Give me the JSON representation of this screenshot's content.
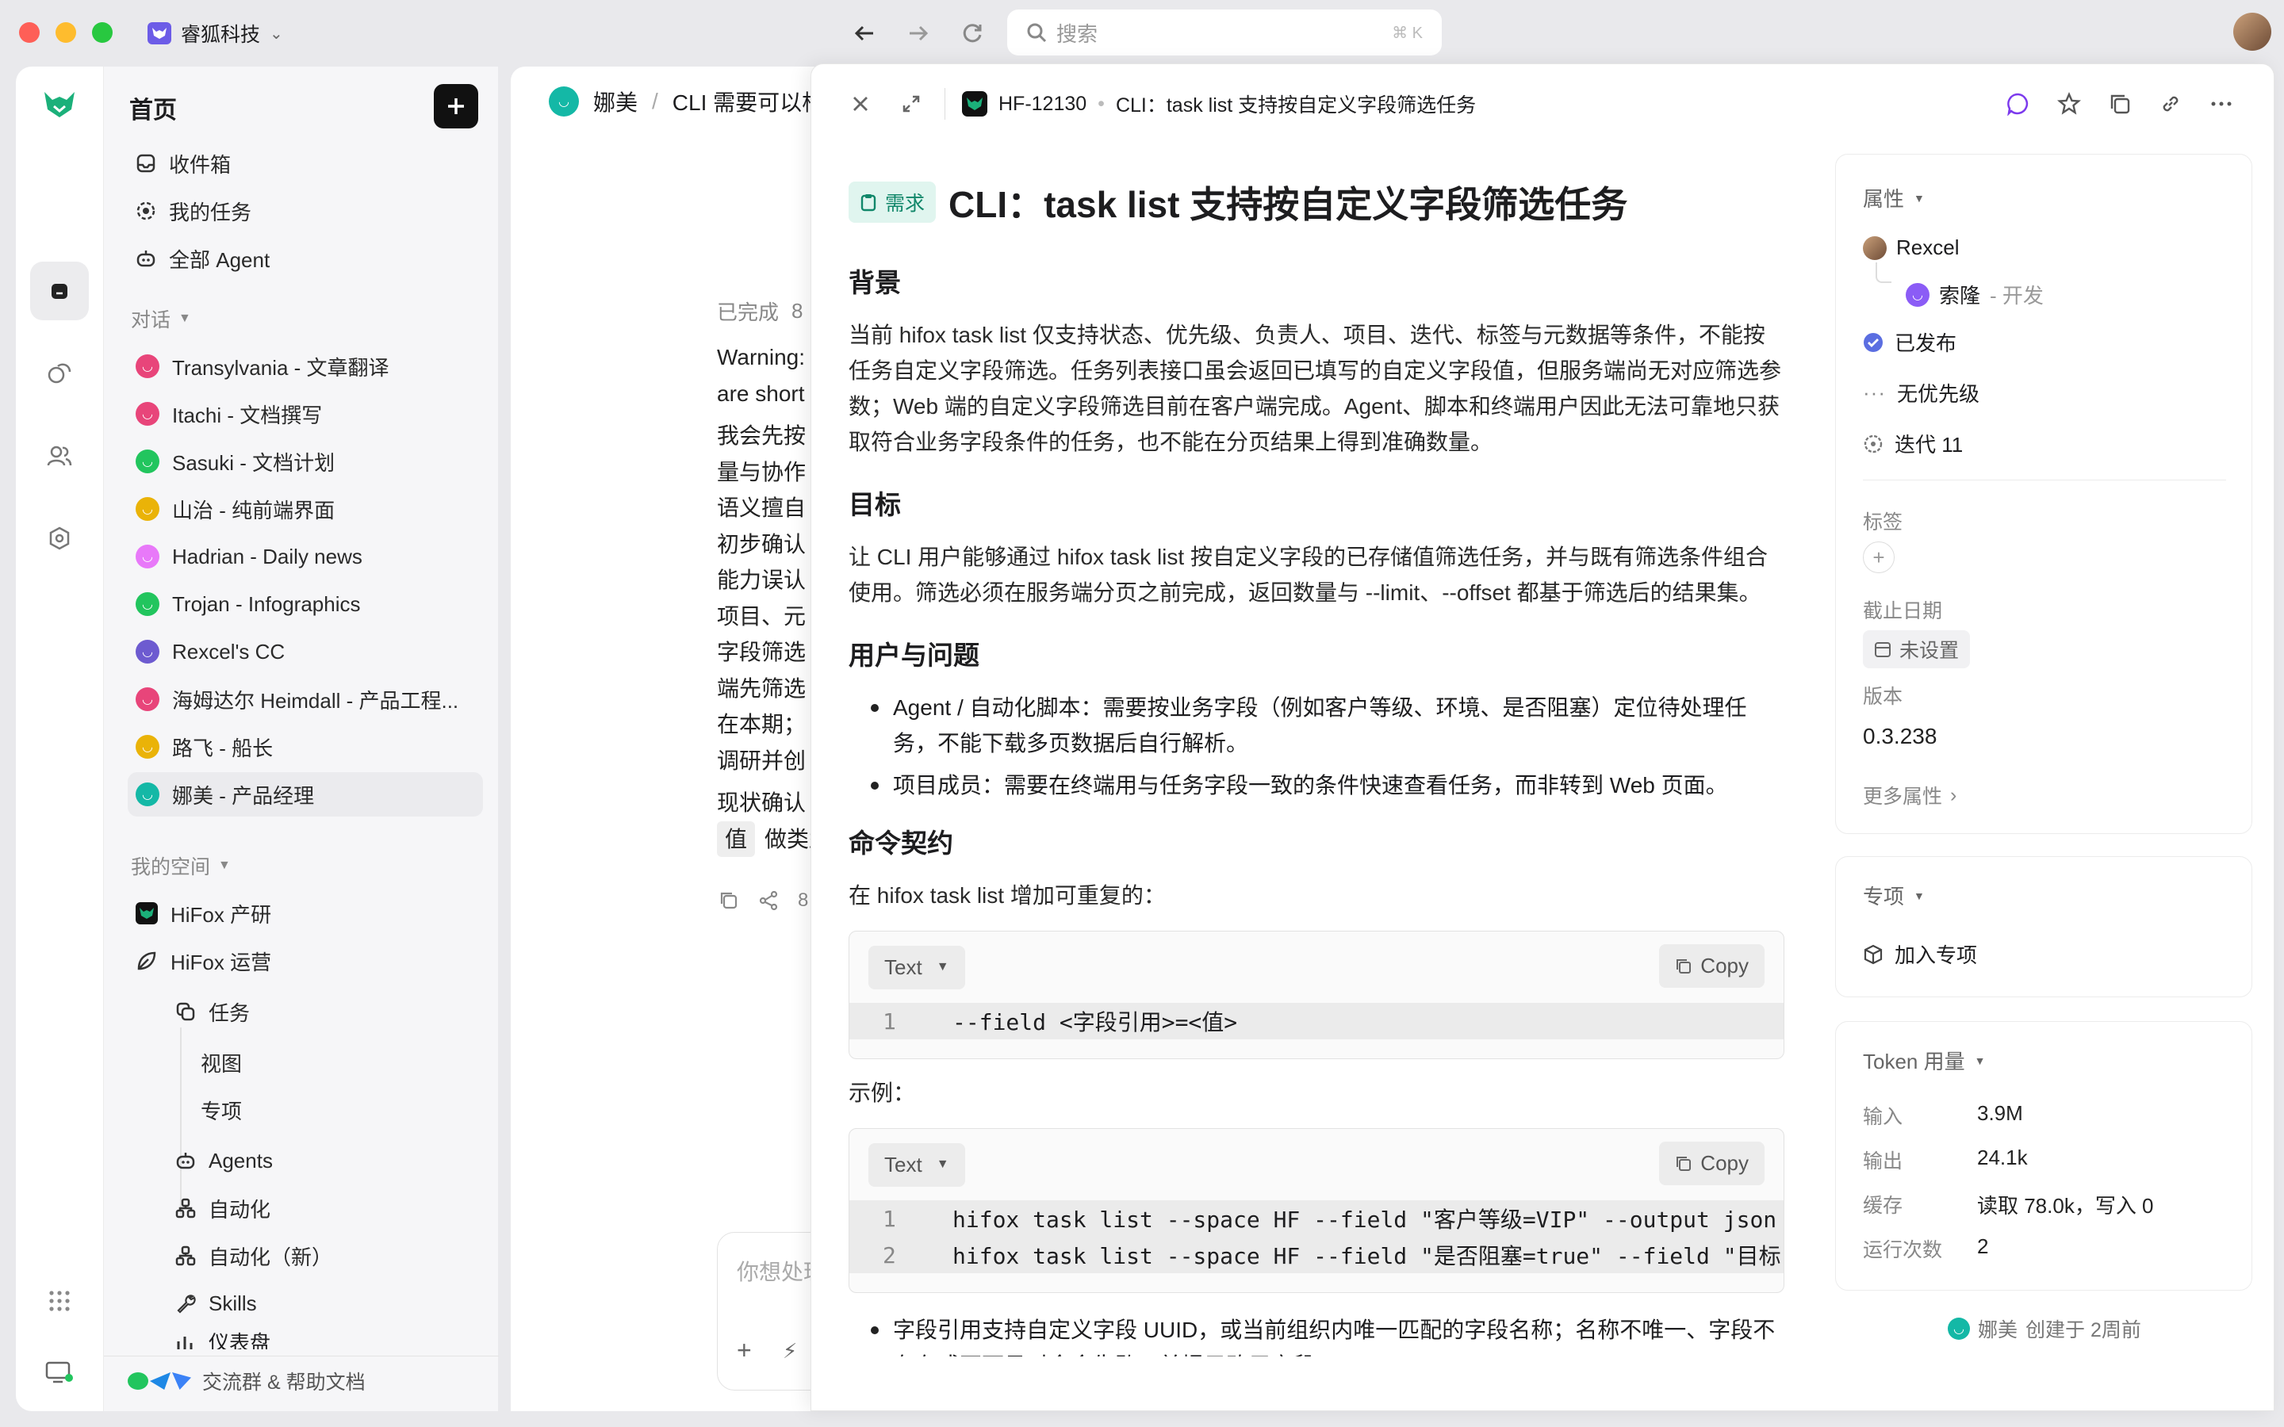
{
  "titlebar": {
    "workspace": "睿狐科技",
    "search_placeholder": "搜索",
    "search_shortcut": "⌘ K"
  },
  "sidebar": {
    "home": "首页",
    "top_items": [
      "收件箱",
      "我的任务",
      "全部 Agent"
    ],
    "chat_section": "对话",
    "chats": [
      {
        "label": "Transylvania - 文章翻译",
        "color": "#e8457a"
      },
      {
        "label": "Itachi - 文档撰写",
        "color": "#e8457a"
      },
      {
        "label": "Sasuki - 文档计划",
        "color": "#22c55e"
      },
      {
        "label": "山治 - 纯前端界面",
        "color": "#eab308"
      },
      {
        "label": "Hadrian - Daily news",
        "color": "#e879f9"
      },
      {
        "label": "Trojan - Infographics",
        "color": "#22c55e"
      },
      {
        "label": "Rexcel's CC",
        "color": "#6d5bd0"
      },
      {
        "label": "海姆达尔 Heimdall - 产品工程...",
        "color": "#e8457a"
      },
      {
        "label": "路飞 - 船长",
        "color": "#eab308"
      },
      {
        "label": "娜美 - 产品经理",
        "color": "#14b8a6"
      }
    ],
    "space_section": "我的空间",
    "spaces": [
      "HiFox 产研",
      "HiFox 运营"
    ],
    "ops_children": [
      "任务",
      "视图",
      "专项",
      "Agents",
      "自动化",
      "自动化（新）",
      "Skills",
      "仪表盘"
    ],
    "footer": "交流群 & 帮助文档"
  },
  "chat": {
    "agent": "娜美",
    "title": "CLI 需要可以根",
    "done_label": "已完成",
    "done_count": "8",
    "lines": [
      "Warning:",
      "are short",
      "我会先按",
      "量与协作",
      "语义擅自",
      "初步确认",
      "能力误认",
      "项目、元",
      "字段筛选",
      "端先筛选",
      "在本期；",
      "调研并创",
      "现状确认",
      "值",
      "做类型"
    ],
    "action_count": "8",
    "input_placeholder": "你想处理"
  },
  "issue": {
    "key": "HF-12130",
    "breadcrumb_title": "CLI：task list 支持按自定义字段筛选任务",
    "badge": "需求",
    "title": "CLI：task list 支持按自定义字段筛选任务",
    "bg_h": "背景",
    "bg_p": "当前 hifox task list 仅支持状态、优先级、负责人、项目、迭代、标签与元数据等条件，不能按任务自定义字段筛选。任务列表接口虽会返回已填写的自定义字段值，但服务端尚无对应筛选参数；Web 端的自定义字段筛选目前在客户端完成。Agent、脚本和终端用户因此无法可靠地只获取符合业务字段条件的任务，也不能在分页结果上得到准确数量。",
    "goal_h": "目标",
    "goal_p": "让 CLI 用户能够通过 hifox task list 按自定义字段的已存储值筛选任务，并与既有筛选条件组合使用。筛选必须在服务端分页之前完成，返回数量与 --limit、--offset 都基于筛选后的结果集。",
    "users_h": "用户与问题",
    "users": [
      "Agent / 自动化脚本：需要按业务字段（例如客户等级、环境、是否阻塞）定位待处理任务，不能下载多页数据后自行解析。",
      "项目成员：需要在终端用与任务字段一致的条件快速查看任务，而非转到 Web 页面。"
    ],
    "cmd_h": "命令契约",
    "cmd_p": "在 hifox task list 增加可重复的：",
    "code1": {
      "lang": "Text",
      "copy": "Copy",
      "lines": [
        {
          "n": "1",
          "text": "--field <字段引用>=<值>"
        }
      ]
    },
    "example_label": "示例：",
    "code2": {
      "lang": "Text",
      "copy": "Copy",
      "lines": [
        {
          "n": "1",
          "text": "hifox task list --space HF --field \"客户等级=VIP\" --output json"
        },
        {
          "n": "2",
          "text": "hifox task list --space HF --field \"是否阻塞=true\" --field \"目标"
        }
      ]
    },
    "tail": "字段引用支持自定义字段 UUID，或当前组织内唯一匹配的字段名称；名称不唯一、字段不存在或不可见时命令失败，并提示改用字段 UUID。"
  },
  "props": {
    "section": "属性",
    "owner": "Rexcel",
    "assignee": "索隆",
    "assignee_role": "- 开发",
    "status": "已发布",
    "priority": "无优先级",
    "iteration": "迭代 11",
    "tags_label": "标签",
    "due_label": "截止日期",
    "due_value": "未设置",
    "version_label": "版本",
    "version_value": "0.3.238",
    "more": "更多属性",
    "project_section": "专项",
    "project_add": "加入专项",
    "token_section": "Token 用量",
    "token_rows": [
      {
        "k": "输入",
        "v": "3.9M"
      },
      {
        "k": "输出",
        "v": "24.1k"
      },
      {
        "k": "缓存",
        "v": "读取 78.0k，写入 0"
      },
      {
        "k": "运行次数",
        "v": "2"
      }
    ],
    "creator": "娜美",
    "created": "创建于 2周前"
  }
}
